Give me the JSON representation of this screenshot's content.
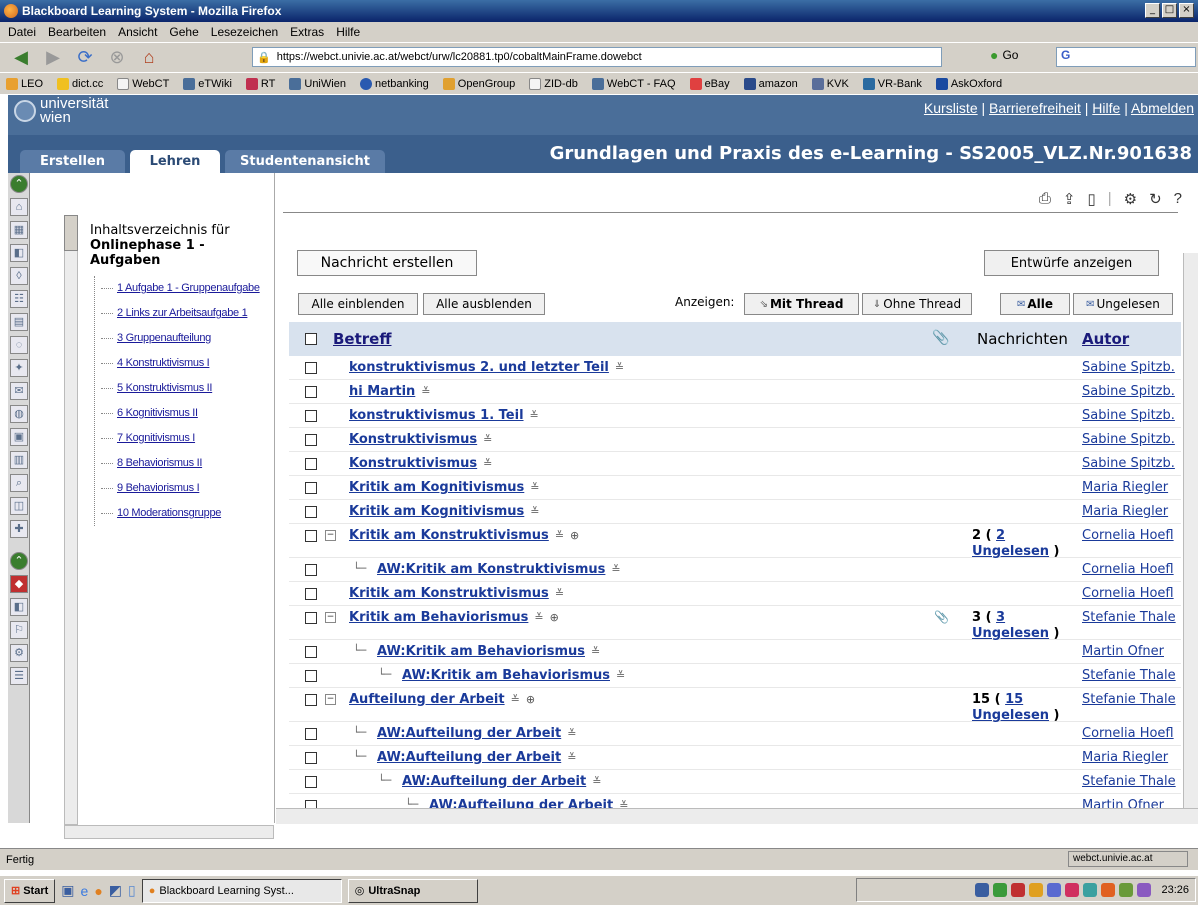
{
  "window": {
    "title": "Blackboard Learning System - Mozilla Firefox"
  },
  "menu": [
    "Datei",
    "Bearbeiten",
    "Ansicht",
    "Gehe",
    "Lesezeichen",
    "Extras",
    "Hilfe"
  ],
  "address": {
    "url": "https://webct.univie.ac.at/webct/urw/lc20881.tp0/cobaltMainFrame.dowebct",
    "go_label": "Go",
    "search_value": "G"
  },
  "bookmarks": [
    "LEO",
    "dict.cc",
    "WebCT",
    "eTWiki",
    "RT",
    "UniWien",
    "netbanking",
    "OpenGroup",
    "ZID-db",
    "WebCT - FAQ",
    "eBay",
    "amazon",
    "KVK",
    "VR-Bank",
    "AskOxford"
  ],
  "header": {
    "logo_line1": "universität",
    "logo_line2": "wien",
    "links": {
      "courses": "Kursliste",
      "accessibility": "Barrierefreiheit",
      "help": "Hilfe",
      "logout": "Abmelden"
    },
    "separator": "|"
  },
  "tabs": {
    "create": "Erstellen",
    "teach": "Lehren",
    "student": "Studentenansicht"
  },
  "course_title": "Grundlagen und Praxis des e-Learning - SS2005_VLZ.Nr.901638",
  "toc": {
    "heading_plain": "Inhaltsverzeichnis für",
    "heading_bold": "Onlinephase 1 - Aufgaben",
    "items": [
      "1 Aufgabe 1 - Gruppenaufgabe",
      "2 Links zur Arbeitsaufgabe 1",
      "3 Gruppenaufteilung",
      "4 Konstruktivismus I",
      "5 Konstruktivismus II",
      "6 Kognitivismus II",
      "7 Kognitivismus I",
      "8 Behaviorismus II",
      "9 Behaviorismus I",
      "10 Moderationsgruppe"
    ]
  },
  "buttons": {
    "new_message": "Nachricht erstellen",
    "show_drafts": "Entwürfe anzeigen",
    "expand_all": "Alle einblenden",
    "collapse_all": "Alle ausblenden",
    "display_label": "Anzeigen:",
    "with_thread": "Mit Thread",
    "without_thread": "Ohne Thread",
    "all": "Alle",
    "unread": "Ungelesen"
  },
  "table": {
    "headers": {
      "subject": "Betreff",
      "messages": "Nachrichten",
      "author": "Autor"
    },
    "rows": [
      {
        "subject": "konstruktivismus 2. und letzter Teil",
        "author": "Sabine Spitzb.",
        "indent": 0,
        "thread": false
      },
      {
        "subject": "hi Martin",
        "author": "Sabine Spitzb.",
        "indent": 0,
        "thread": false
      },
      {
        "subject": "konstruktivismus 1. Teil",
        "author": "Sabine Spitzb.",
        "indent": 0,
        "thread": false
      },
      {
        "subject": "Konstruktivismus",
        "author": "Sabine Spitzb.",
        "indent": 0,
        "thread": false
      },
      {
        "subject": "Konstruktivismus",
        "author": "Sabine Spitzb.",
        "indent": 0,
        "thread": false
      },
      {
        "subject": "Kritik am Kognitivismus",
        "author": "Maria Riegler",
        "indent": 0,
        "thread": false
      },
      {
        "subject": "Kritik am Kognitivismus",
        "author": "Maria Riegler",
        "indent": 0,
        "thread": false
      },
      {
        "subject": "Kritik am Konstruktivismus",
        "author": "Cornelia Hoefl",
        "indent": 0,
        "thread": true,
        "count": "2",
        "unread": "2",
        "unread_label": "Ungelesen"
      },
      {
        "subject": "AW:Kritik am Konstruktivismus",
        "author": "Cornelia Hoefl",
        "indent": 1,
        "thread": false
      },
      {
        "subject": "Kritik am Konstruktivismus",
        "author": "Cornelia Hoefl",
        "indent": 0,
        "thread": false
      },
      {
        "subject": "Kritik am Behaviorismus",
        "author": "Stefanie Thale",
        "indent": 0,
        "thread": true,
        "count": "3",
        "unread": "3",
        "unread_label": "Ungelesen",
        "attachment": true
      },
      {
        "subject": "AW:Kritik am Behaviorismus",
        "author": "Martin Ofner",
        "indent": 1,
        "thread": false
      },
      {
        "subject": "AW:Kritik am Behaviorismus",
        "author": "Stefanie Thale",
        "indent": 2,
        "thread": false
      },
      {
        "subject": "Aufteilung der Arbeit",
        "author": "Stefanie Thale",
        "indent": 0,
        "thread": true,
        "count": "15",
        "unread": "15",
        "unread_label": "Ungelesen"
      },
      {
        "subject": "AW:Aufteilung der Arbeit",
        "author": "Cornelia Hoefl",
        "indent": 1,
        "thread": false
      },
      {
        "subject": "AW:Aufteilung der Arbeit",
        "author": "Maria Riegler",
        "indent": 1,
        "thread": false
      },
      {
        "subject": "AW:Aufteilung der Arbeit",
        "author": "Stefanie Thale",
        "indent": 2,
        "thread": false
      },
      {
        "subject": "AW:Aufteilung der Arbeit",
        "author": "Martin Ofner",
        "indent": 3,
        "thread": false
      }
    ]
  },
  "status": {
    "left": "Fertig",
    "right": "webct.univie.ac.at"
  },
  "taskbar": {
    "start": "Start",
    "task1": "Blackboard Learning Syst...",
    "task2": "UltraSnap",
    "clock": "23:26"
  }
}
